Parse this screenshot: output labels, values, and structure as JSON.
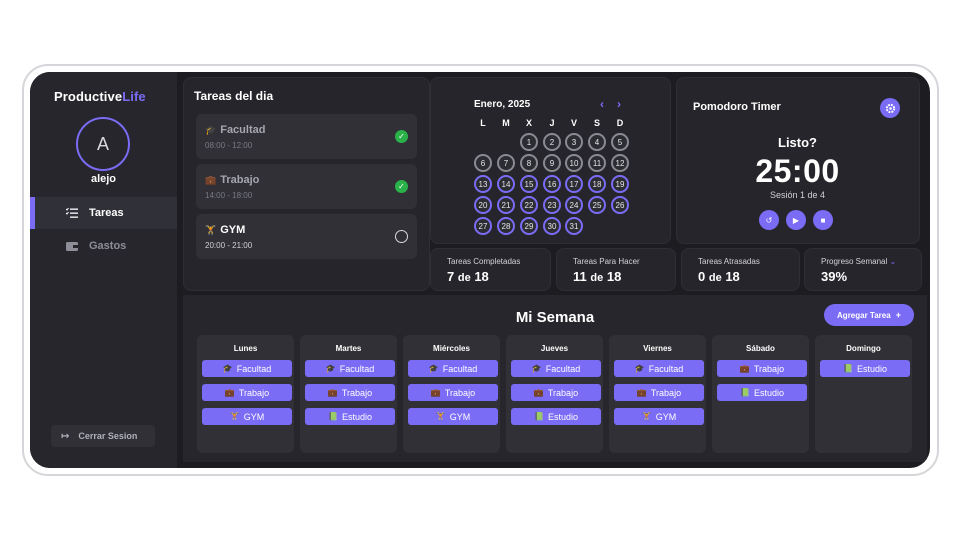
{
  "brand": {
    "part1": "Productive",
    "part2": "Life"
  },
  "user": {
    "initial": "A",
    "name": "alejo"
  },
  "nav": [
    {
      "label": "Tareas",
      "icon": "list-check-icon",
      "active": true
    },
    {
      "label": "Gastos",
      "icon": "wallet-icon",
      "active": false
    }
  ],
  "logout_label": "Cerrar Sesion",
  "tasks": {
    "title": "Tareas del dia",
    "items": [
      {
        "name": "Facultad",
        "time": "08:00 - 12:00",
        "done": true,
        "emoji": "🎓"
      },
      {
        "name": "Trabajo",
        "time": "14:00 - 18:00",
        "done": true,
        "emoji": "💼"
      },
      {
        "name": "GYM",
        "time": "20:00 - 21:00",
        "done": false,
        "emoji": "🏋"
      }
    ]
  },
  "calendar": {
    "month": "Enero, 2025",
    "prev": "‹",
    "next": "›",
    "weekdays": [
      "L",
      "M",
      "X",
      "J",
      "V",
      "S",
      "D"
    ],
    "first_weekday_index": 2,
    "days_in_month": 31,
    "last_past_day": 12
  },
  "pomodoro": {
    "title": "Pomodoro Timer",
    "status": "Listo?",
    "time": "25:00",
    "session": "Sesión 1 de 4"
  },
  "stats": [
    {
      "label": "Tareas Completadas",
      "value_a": "7",
      "sep": "de",
      "value_b": "18"
    },
    {
      "label": "Tareas Para Hacer",
      "value_a": "11",
      "sep": "de",
      "value_b": "18"
    },
    {
      "label": "Tareas Atrasadas",
      "value_a": "0",
      "sep": "de",
      "value_b": "18"
    },
    {
      "label": "Progreso Semanal",
      "value": "39%"
    }
  ],
  "week": {
    "title": "Mi Semana",
    "add_label": "Agregar Tarea",
    "add_symbol": "+",
    "days": [
      {
        "name": "Lunes",
        "tasks": [
          {
            "emoji": "🎓",
            "label": "Facultad"
          },
          {
            "emoji": "💼",
            "label": "Trabajo"
          },
          {
            "emoji": "🏋",
            "label": "GYM"
          }
        ]
      },
      {
        "name": "Martes",
        "tasks": [
          {
            "emoji": "🎓",
            "label": "Facultad"
          },
          {
            "emoji": "💼",
            "label": "Trabajo"
          },
          {
            "emoji": "📗",
            "label": "Estudio"
          }
        ]
      },
      {
        "name": "Miércoles",
        "tasks": [
          {
            "emoji": "🎓",
            "label": "Facultad"
          },
          {
            "emoji": "💼",
            "label": "Trabajo"
          },
          {
            "emoji": "🏋",
            "label": "GYM"
          }
        ]
      },
      {
        "name": "Jueves",
        "tasks": [
          {
            "emoji": "🎓",
            "label": "Facultad"
          },
          {
            "emoji": "💼",
            "label": "Trabajo"
          },
          {
            "emoji": "📗",
            "label": "Estudio"
          }
        ]
      },
      {
        "name": "Viernes",
        "tasks": [
          {
            "emoji": "🎓",
            "label": "Facultad"
          },
          {
            "emoji": "💼",
            "label": "Trabajo"
          },
          {
            "emoji": "🏋",
            "label": "GYM"
          }
        ]
      },
      {
        "name": "Sábado",
        "tasks": [
          {
            "emoji": "💼",
            "label": "Trabajo"
          },
          {
            "emoji": "📗",
            "label": "Estudio"
          }
        ]
      },
      {
        "name": "Domingo",
        "tasks": [
          {
            "emoji": "📗",
            "label": "Estudio"
          }
        ]
      }
    ]
  },
  "colors": {
    "accent": "#7b6cf6",
    "done": "#2bb14a",
    "background": "#1c1c21",
    "panel": "#25252b"
  }
}
